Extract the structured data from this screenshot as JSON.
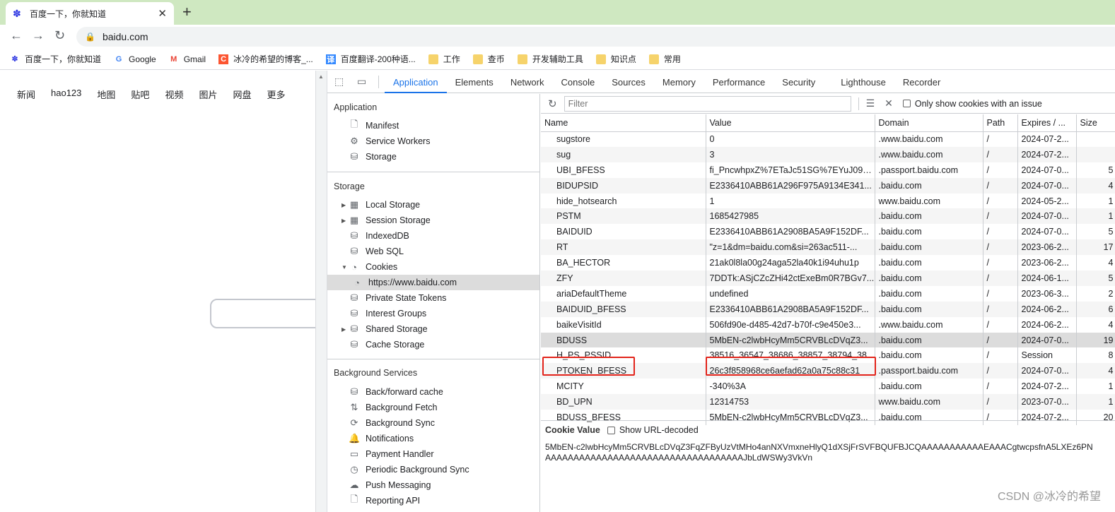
{
  "browser": {
    "tab_title": "百度一下，你就知道",
    "close_glyph": "✕",
    "new_tab_glyph": "+",
    "url": "baidu.com",
    "bookmarks": [
      {
        "label": "百度一下，你就知道",
        "icon": "baidu-paw-icon"
      },
      {
        "label": "Google",
        "icon": "google-icon"
      },
      {
        "label": "Gmail",
        "icon": "gmail-icon"
      },
      {
        "label": "冰冷的希望的博客_...",
        "icon": "csdn-icon"
      },
      {
        "label": "百度翻译-200种语...",
        "icon": "translate-icon"
      },
      {
        "label": "工作",
        "icon": "folder-icon"
      },
      {
        "label": "查币",
        "icon": "folder-icon"
      },
      {
        "label": "开发辅助工具",
        "icon": "folder-icon"
      },
      {
        "label": "知识点",
        "icon": "folder-icon"
      },
      {
        "label": "常用",
        "icon": "folder-icon"
      }
    ]
  },
  "page": {
    "nav": [
      "新闻",
      "hao123",
      "地图",
      "贴吧",
      "视频",
      "图片",
      "网盘",
      "更多"
    ]
  },
  "devtools": {
    "tabs": [
      "Application",
      "Elements",
      "Network",
      "Console",
      "Sources",
      "Memory",
      "Performance",
      "Security",
      "Lighthouse",
      "Recorder"
    ],
    "active_tab": "Application",
    "sidebar": {
      "application_title": "Application",
      "application_items": [
        "Manifest",
        "Service Workers",
        "Storage"
      ],
      "storage_title": "Storage",
      "storage_items": [
        "Local Storage",
        "Session Storage",
        "IndexedDB",
        "Web SQL",
        "Cookies",
        "https://www.baidu.com",
        "Private State Tokens",
        "Interest Groups",
        "Shared Storage",
        "Cache Storage"
      ],
      "background_title": "Background Services",
      "background_items": [
        "Back/forward cache",
        "Background Fetch",
        "Background Sync",
        "Notifications",
        "Payment Handler",
        "Periodic Background Sync",
        "Push Messaging",
        "Reporting API"
      ]
    },
    "filter_placeholder": "Filter",
    "only_issue_label": "Only show cookies with an issue",
    "columns": [
      "Name",
      "Value",
      "Domain",
      "Path",
      "Expires / ...",
      "Size"
    ],
    "cookies": [
      {
        "name": "sugstore",
        "value": "0",
        "domain": ".www.baidu.com",
        "path": "/",
        "expires": "2024-07-2...",
        "size": ""
      },
      {
        "name": "sug",
        "value": "3",
        "domain": ".www.baidu.com",
        "path": "/",
        "expires": "2024-07-2...",
        "size": ""
      },
      {
        "name": "UBI_BFESS",
        "value": "fi_PncwhpxZ%7ETaJc51SG%7EYuJ09s...",
        "domain": ".passport.baidu.com",
        "path": "/",
        "expires": "2024-07-0...",
        "size": "5"
      },
      {
        "name": "BIDUPSID",
        "value": "E2336410ABB61A296F975A9134E341...",
        "domain": ".baidu.com",
        "path": "/",
        "expires": "2024-07-0...",
        "size": "4"
      },
      {
        "name": "hide_hotsearch",
        "value": "1",
        "domain": "www.baidu.com",
        "path": "/",
        "expires": "2024-05-2...",
        "size": "1"
      },
      {
        "name": "PSTM",
        "value": "1685427985",
        "domain": ".baidu.com",
        "path": "/",
        "expires": "2024-07-0...",
        "size": "1"
      },
      {
        "name": "BAIDUID",
        "value": "E2336410ABB61A2908BA5A9F152DF...",
        "domain": ".baidu.com",
        "path": "/",
        "expires": "2024-07-0...",
        "size": "5"
      },
      {
        "name": "RT",
        "value": "\"z=1&dm=baidu.com&si=263ac511-...",
        "domain": ".baidu.com",
        "path": "/",
        "expires": "2023-06-2...",
        "size": "17"
      },
      {
        "name": "BA_HECTOR",
        "value": "21ak0l8la00g24aga52la40k1i94uhu1p",
        "domain": ".baidu.com",
        "path": "/",
        "expires": "2023-06-2...",
        "size": "4"
      },
      {
        "name": "ZFY",
        "value": "7DDTk:ASjCZcZHi42ctExeBm0R7BGv7...",
        "domain": ".baidu.com",
        "path": "/",
        "expires": "2024-06-1...",
        "size": "5"
      },
      {
        "name": "ariaDefaultTheme",
        "value": "undefined",
        "domain": ".baidu.com",
        "path": "/",
        "expires": "2023-06-3...",
        "size": "2"
      },
      {
        "name": "BAIDUID_BFESS",
        "value": "E2336410ABB61A2908BA5A9F152DF...",
        "domain": ".baidu.com",
        "path": "/",
        "expires": "2024-06-2...",
        "size": "6"
      },
      {
        "name": "baikeVisitId",
        "value": "506fd90e-d485-42d7-b70f-c9e450e3...",
        "domain": ".www.baidu.com",
        "path": "/",
        "expires": "2024-06-2...",
        "size": "4"
      },
      {
        "name": "BDUSS",
        "value": "5MbEN-c2lwbHcyMm5CRVBLcDVqZ3...",
        "domain": ".baidu.com",
        "path": "/",
        "expires": "2024-07-0...",
        "size": "19"
      },
      {
        "name": "H_PS_PSSID",
        "value": "38516_36547_38686_38857_38794_38...",
        "domain": ".baidu.com",
        "path": "/",
        "expires": "Session",
        "size": "8"
      },
      {
        "name": "PTOKEN_BFESS",
        "value": "26c3f858968ce6aefad62a0a75c88c31",
        "domain": ".passport.baidu.com",
        "path": "/",
        "expires": "2024-07-0...",
        "size": "4"
      },
      {
        "name": "MCITY",
        "value": "-340%3A",
        "domain": ".baidu.com",
        "path": "/",
        "expires": "2024-07-2...",
        "size": "1"
      },
      {
        "name": "BD_UPN",
        "value": "12314753",
        "domain": "www.baidu.com",
        "path": "/",
        "expires": "2023-07-0...",
        "size": "1"
      },
      {
        "name": "BDUSS_BFESS",
        "value": "5MbEN-c2lwbHcyMm5CRVBLcDVqZ3...",
        "domain": ".baidu.com",
        "path": "/",
        "expires": "2024-07-2...",
        "size": "20"
      }
    ],
    "selected_cookie": "BDUSS",
    "cookie_value_title": "Cookie Value",
    "show_url_decoded_label": "Show URL-decoded",
    "cookie_value_line1": "5MbEN-c2lwbHcyMm5CRVBLcDVqZ3FqZFByUzVtMHo4anNXVmxneHlyQ1dXSjFrSVFBQUFBJCQAAAAAAAAAAAEAAACgtwcpsfnA5LXEz6PN",
    "cookie_value_line2": "AAAAAAAAAAAAAAAAAAAAAAAAAAAAAAAAAAAJbLdWSWy3VkVn"
  },
  "watermark": "CSDN @冰冷的希望",
  "colors": {
    "accent": "#1a73e8",
    "highlight": "#e2231a",
    "tabstrip": "#cfe8c1"
  }
}
